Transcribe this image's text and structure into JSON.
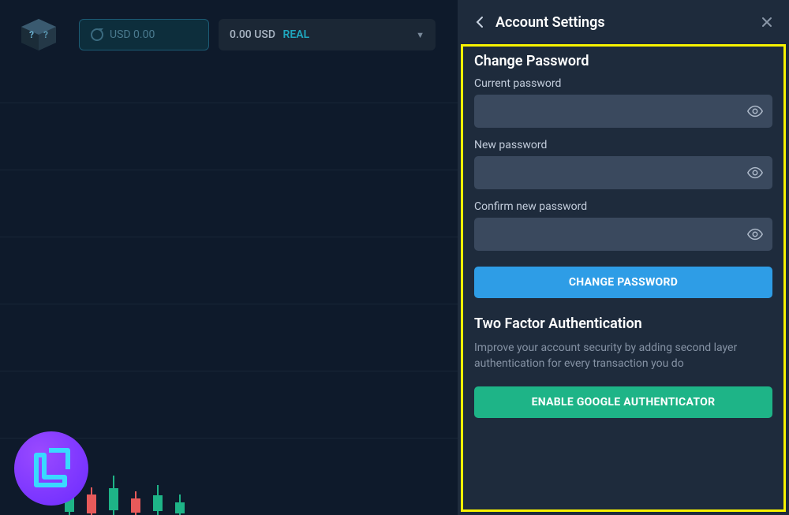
{
  "topbar": {
    "usd_pill_label": "USD 0.00",
    "balance_amount": "0.00 USD",
    "balance_tag": "REAL"
  },
  "panel": {
    "title": "Account Settings",
    "change_password": {
      "heading": "Change Password",
      "current_label": "Current password",
      "new_label": "New password",
      "confirm_label": "Confirm new password",
      "button": "CHANGE PASSWORD"
    },
    "twofa": {
      "heading": "Two Factor Authentication",
      "description": "Improve your account security by adding second layer authentication for every transaction you do",
      "button": "ENABLE GOOGLE AUTHENTICATOR"
    }
  },
  "colors": {
    "accent_blue": "#2e9de6",
    "accent_green": "#1eb487",
    "highlight": "#f7f200"
  }
}
